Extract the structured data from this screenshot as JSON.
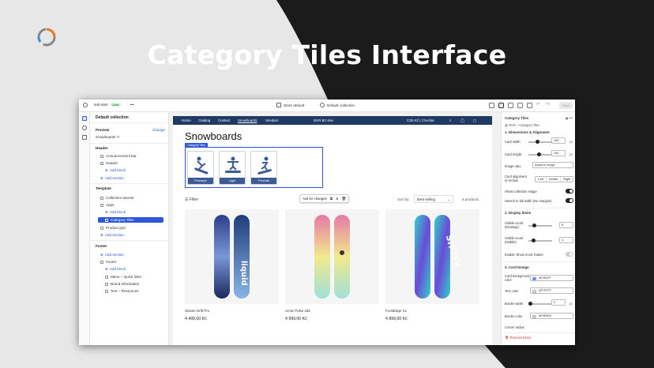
{
  "hero": {
    "title": "Category Tiles Interface"
  },
  "topbar": {
    "store_name": "test-dets",
    "live_badge": "Live",
    "more": "•••",
    "theme": "Store default",
    "page": "Default collection",
    "save": "Save"
  },
  "left_panel": {
    "title": "Default collection",
    "preview_label": "Preview",
    "preview_change": "Change",
    "preview_value": "Snowboards",
    "items": [
      {
        "label": "Header",
        "kind": "section"
      },
      {
        "label": "Announcement bar",
        "kind": "item",
        "indent": 1
      },
      {
        "label": "Header",
        "kind": "item",
        "indent": 1
      },
      {
        "label": "Add block",
        "kind": "link",
        "indent": 2
      },
      {
        "label": "Add section",
        "kind": "link",
        "indent": 1
      },
      {
        "label": "Template",
        "kind": "section"
      },
      {
        "label": "Collection banner",
        "kind": "item",
        "indent": 1
      },
      {
        "label": "Apps",
        "kind": "item",
        "indent": 1
      },
      {
        "label": "Add block",
        "kind": "link",
        "indent": 2
      },
      {
        "label": "Category Tiles",
        "kind": "selected",
        "indent": 2
      },
      {
        "label": "Product grid",
        "kind": "item",
        "indent": 1
      },
      {
        "label": "Add section",
        "kind": "link",
        "indent": 1
      },
      {
        "label": "Footer",
        "kind": "section"
      },
      {
        "label": "Add section",
        "kind": "link",
        "indent": 1
      },
      {
        "label": "Footer",
        "kind": "item",
        "indent": 1
      },
      {
        "label": "Add block",
        "kind": "link",
        "indent": 2
      },
      {
        "label": "Menu – Quick links",
        "kind": "item",
        "indent": 2
      },
      {
        "label": "Brand information",
        "kind": "item",
        "indent": 2
      },
      {
        "label": "Text – Resources",
        "kind": "item",
        "indent": 2
      }
    ]
  },
  "store": {
    "nav": [
      "Home",
      "Catalog",
      "Contact",
      "Snowboards",
      "Vendors"
    ],
    "brand": "NVR BC-dev",
    "currency": "CZK Kč | Czechia",
    "collection_title": "Snowboards",
    "block_tag": "Category Tiles",
    "tiles": [
      "Freestyle",
      "Light",
      "Freeride"
    ],
    "filter": "Filter",
    "ask": "Ask for changes",
    "sort_label": "Sort by:",
    "sort_value": "Best selling",
    "count": "6 products",
    "products": [
      {
        "name": "Glacier Drift Pro",
        "price": "4 499,00 Kč"
      },
      {
        "name": "Arctic Pulse 158",
        "price": "4 999,00 Kč"
      },
      {
        "name": "FrostEdge X1",
        "price": "4 899,00 Kč"
      }
    ]
  },
  "right_panel": {
    "title": "Category Tiles",
    "subtitle": "NVR – Category Tiles",
    "sec1": "1. Dimensions & Alignment",
    "card_width": "Card width",
    "card_width_val": "105",
    "card_height": "Card height",
    "card_height_val": "160",
    "px": "px",
    "image_ratio": "Image ratio",
    "image_ratio_val": "Adapt to image",
    "alignment": "Card alignment in section",
    "align_opts": [
      "Left",
      "Center",
      "Right"
    ],
    "show_image": "Show collection image",
    "stretch": "Stretch to full width (No margins)",
    "sec2": "2. Display limits",
    "visible_desktop": "Visible count (Desktop)",
    "visible_desktop_val": "6",
    "visible_mobile": "Visible count (Mobile)",
    "visible_mobile_val": "4",
    "show_more": "Enable 'Show more' button",
    "sec3": "3. Card Design",
    "card_bg": "Card background color",
    "card_bg_val": "#678DFF",
    "text_color": "Text color",
    "text_color_val": "#FFFFFF",
    "border_width": "Border width",
    "border_width_val": "0",
    "border_color": "Border color",
    "border_color_val": "#E5E5E5",
    "corner_radius": "Corner radius",
    "remove": "Remove block",
    "colors": {
      "card_bg": "#678DFF",
      "text": "#FFFFFF",
      "border": "#E5E5E5"
    }
  }
}
